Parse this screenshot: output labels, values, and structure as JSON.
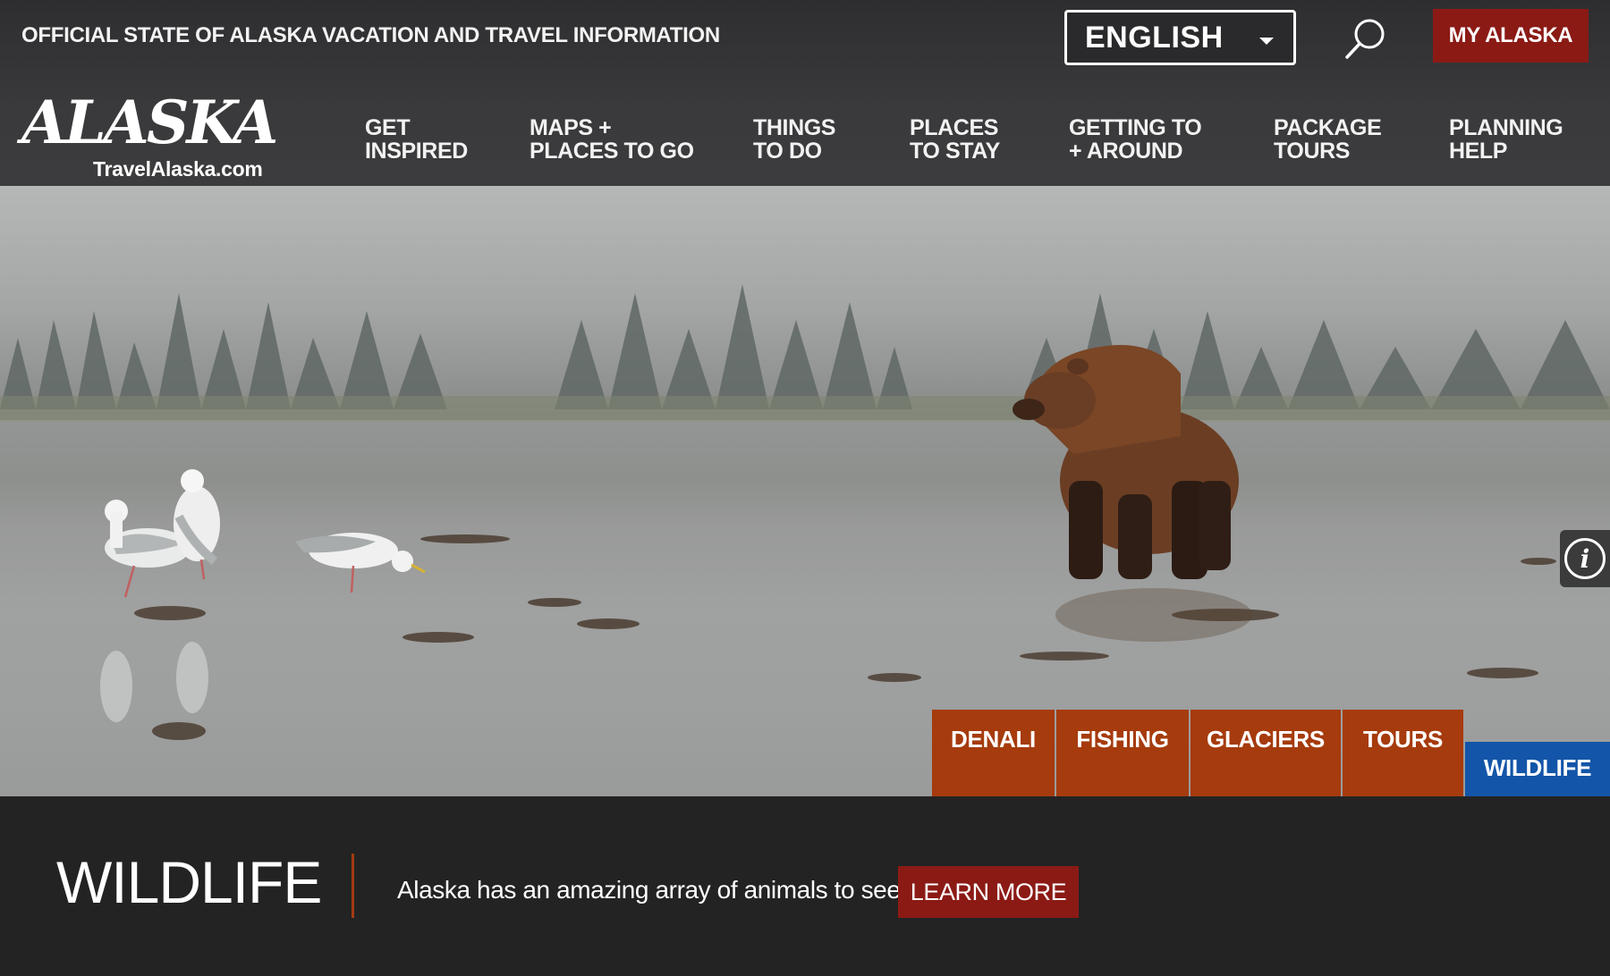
{
  "header": {
    "tagline": "OFFICIAL STATE OF ALASKA VACATION AND TRAVEL INFORMATION",
    "language": {
      "selected": "ENGLISH"
    },
    "search_icon": "search-icon",
    "my_alaska_label": "MY ALASKA",
    "logo": {
      "wordmark": "ALASKA",
      "url": "TravelAlaska.com"
    }
  },
  "nav": {
    "items": [
      {
        "line1": "GET",
        "line2": "INSPIRED"
      },
      {
        "line1": "MAPS +",
        "line2": "PLACES TO GO"
      },
      {
        "line1": "THINGS",
        "line2": "TO DO"
      },
      {
        "line1": "PLACES",
        "line2": "TO STAY"
      },
      {
        "line1": "GETTING TO",
        "line2": "+ AROUND"
      },
      {
        "line1": "PACKAGE",
        "line2": "TOURS"
      },
      {
        "line1": "PLANNING",
        "line2": "HELP"
      }
    ]
  },
  "hero": {
    "info_icon": "info-icon",
    "tabs": [
      {
        "label": "DENALI",
        "active": false
      },
      {
        "label": "FISHING",
        "active": false
      },
      {
        "label": "GLACIERS",
        "active": false
      },
      {
        "label": "TOURS",
        "active": false
      },
      {
        "label": "WILDLIFE",
        "active": true
      }
    ]
  },
  "feature": {
    "title": "WILDLIFE",
    "description": "Alaska has an amazing array of animals to see",
    "cta_label": "LEARN MORE"
  },
  "colors": {
    "header_bg": "#3a3a3c",
    "brand_red": "#8b1a15",
    "tab_orange": "#a63b0d",
    "tab_active_blue": "#1355a8",
    "feature_bg": "#232323"
  }
}
